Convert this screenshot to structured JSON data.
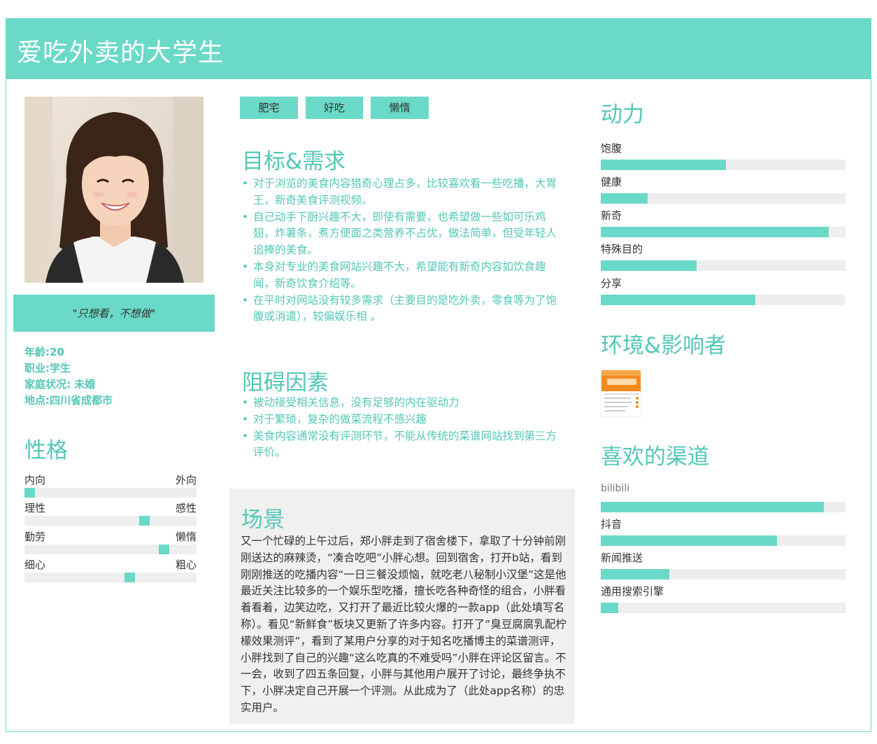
{
  "header": {
    "title": "爱吃外卖的大学生"
  },
  "persona": {
    "quote": "\"只想看，不想做\"",
    "age_label": "年龄:",
    "age": "20",
    "job_label": "职业:",
    "job": "学生",
    "family_label": "家庭状况: ",
    "family": "未婚",
    "location_label": "地点:",
    "location": "四川省成都市"
  },
  "personality": {
    "title": "性格",
    "traits": [
      {
        "left": "内向",
        "right": "外向",
        "value": 0.0
      },
      {
        "left": "理性",
        "right": "感性",
        "value": 0.71
      },
      {
        "left": "勤劳",
        "right": "懒惰",
        "value": 0.83
      },
      {
        "left": "细心",
        "right": "粗心",
        "value": 0.62
      }
    ]
  },
  "tags": [
    "肥宅",
    "好吃",
    "懒惰"
  ],
  "goals": {
    "title": "目标&需求",
    "items": [
      "对于浏览的美食内容猎奇心理占多，比较喜欢看一些吃播，大胃王，新奇美食评测视频。",
      "自己动手下厨兴趣不大，即使有需要，也希望做一些如可乐鸡翅，炸薯条，煮方便面之类营养不占优，做法简单，但受年轻人追捧的美食。",
      "本身对专业的美食网站兴趣不大，希望能有新奇内容如饮食趣闻，新奇饮食介绍等。",
      "在平时对网站没有较多需求（主要目的是吃外卖，零食等为了饱腹或消遣），较偏娱乐相 。"
    ]
  },
  "obstacles": {
    "title": "阻碍因素",
    "items": [
      "被动接受相关信息，没有足够的内在驱动力",
      "对于繁琐，复杂的做菜流程不感兴趣",
      "美食内容通常没有评测环节，不能从传统的菜谱网站找到第三方评价。"
    ]
  },
  "scene": {
    "title": "场景",
    "text": "又一个忙碌的上午过后，郑小胖走到了宿舍楼下，拿取了十分钟前刚刚送达的麻辣烫，“凑合吃吧”小胖心想。回到宿舍，打开b站，看到刚刚推送的吃播内容“一日三餐没烦恼，就吃老八秘制小汉堡”这是他最近关注比较多的一个娱乐型吃播，擅长吃各种奇怪的组合，小胖看着看着，边笑边吃，又打开了最近比较火爆的一款app（此处填写名称）。看见“新鲜食”板块又更新了许多内容。打开了“臭豆腐腐乳配柠檬效果测评”，看到了某用户分享的对于知名吃播博主的菜谱测评，小胖找到了自己的兴趣“这么吃真的不难受吗”小胖在评论区留言。不一会，收到了四五条回复，小胖与其他用户展开了讨论，最终争执不下，小胖决定自己开展一个评测。从此成为了（此处app名称）的忠实用户。"
  },
  "motivation": {
    "title": "动力",
    "items": [
      {
        "label": "饱腹",
        "value": 0.51
      },
      {
        "label": "健康",
        "value": 0.19
      },
      {
        "label": "新奇",
        "value": 0.93
      },
      {
        "label": "特殊目的",
        "value": 0.39
      },
      {
        "label": "分享",
        "value": 0.63
      }
    ]
  },
  "environment": {
    "title": "环境&影响者"
  },
  "channels": {
    "title": "喜欢的渠道",
    "items": [
      {
        "label": "bilibili",
        "value": 0.91
      },
      {
        "label": "抖音",
        "value": 0.72
      },
      {
        "label": "新闻推送",
        "value": 0.28
      },
      {
        "label": "通用搜索引擎",
        "value": 0.07
      }
    ]
  },
  "colors": {
    "accent": "#6ad9c7",
    "accent_text": "#54c7b5",
    "track": "#eeeeee",
    "scene_bg": "#f0f0f0"
  }
}
